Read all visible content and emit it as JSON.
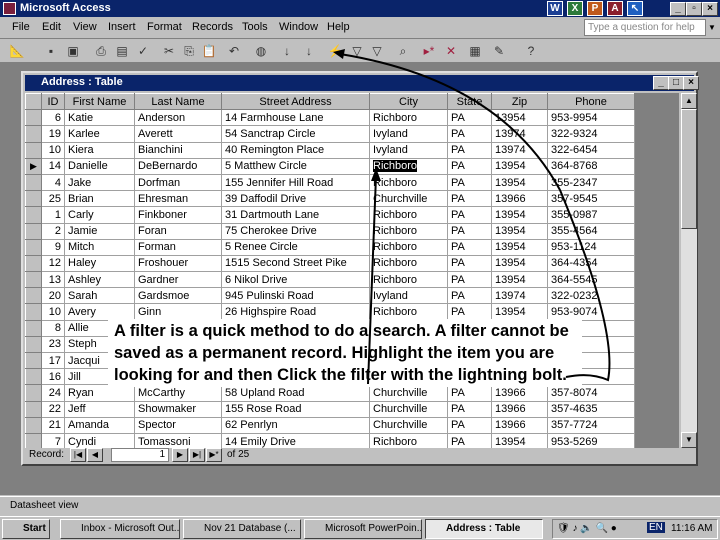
{
  "app": {
    "title": "Microsoft Access",
    "help_placeholder": "Type a question for help"
  },
  "menu": [
    "File",
    "Edit",
    "View",
    "Insert",
    "Format",
    "Records",
    "Tools",
    "Window",
    "Help"
  ],
  "window": {
    "title": "Address : Table"
  },
  "table": {
    "columns": [
      "ID",
      "First Name",
      "Last Name",
      "Street Address",
      "City",
      "State",
      "Zip",
      "Phone"
    ],
    "rows": [
      [
        "6",
        "Katie",
        "Anderson",
        "14 Farmhouse Lane",
        "Richboro",
        "PA",
        "13954",
        "953-9954"
      ],
      [
        "19",
        "Karlee",
        "Averett",
        "54 Sanctrap Circle",
        "Ivyland",
        "PA",
        "13974",
        "322-9324"
      ],
      [
        "10",
        "Kiera",
        "Bianchini",
        "40 Remington Place",
        "Ivyland",
        "PA",
        "13974",
        "322-6454"
      ],
      [
        "14",
        "Danielle",
        "DeBernardo",
        "5 Matthew Circle",
        "Richboro",
        "PA",
        "13954",
        "364-8768"
      ],
      [
        "4",
        "Jake",
        "Dorfman",
        "155 Jennifer Hill Road",
        "Richboro",
        "PA",
        "13954",
        "355-2347"
      ],
      [
        "25",
        "Brian",
        "Ehresman",
        "39 Daffodil Drive",
        "Churchville",
        "PA",
        "13966",
        "357-9545"
      ],
      [
        "1",
        "Carly",
        "Finkboner",
        "31 Dartmouth Lane",
        "Richboro",
        "PA",
        "13954",
        "355-0987"
      ],
      [
        "2",
        "Jamie",
        "Foran",
        "75 Cherokee Drive",
        "Richboro",
        "PA",
        "13954",
        "355-4564"
      ],
      [
        "9",
        "Mitch",
        "Forman",
        "5 Renee Circle",
        "Richboro",
        "PA",
        "13954",
        "953-1124"
      ],
      [
        "12",
        "Haley",
        "Froshouer",
        "1515 Second Street Pike",
        "Richboro",
        "PA",
        "13954",
        "364-4354"
      ],
      [
        "13",
        "Ashley",
        "Gardner",
        "6 Nikol Drive",
        "Richboro",
        "PA",
        "13954",
        "364-5545"
      ],
      [
        "20",
        "Sarah",
        "Gardsmoe",
        "945 Pulinski Road",
        "Ivyland",
        "PA",
        "13974",
        "322-0232"
      ],
      [
        "10",
        "Avery",
        "Ginn",
        "26 Highspire Road",
        "Richboro",
        "PA",
        "13954",
        "953-9074"
      ],
      [
        "8",
        "Allie",
        "",
        "",
        "",
        "",
        "",
        "55"
      ],
      [
        "23",
        "Steph",
        "",
        "",
        "",
        "",
        "",
        "24"
      ],
      [
        "17",
        "Jacqui",
        "",
        "",
        "",
        "",
        "",
        "63"
      ],
      [
        "16",
        "Jill",
        "",
        "",
        "",
        "",
        "",
        "78"
      ],
      [
        "24",
        "Ryan",
        "McCarthy",
        "58 Upland Road",
        "Churchville",
        "PA",
        "13966",
        "357-8074"
      ],
      [
        "22",
        "Jeff",
        "Showmaker",
        "155 Rose Road",
        "Churchville",
        "PA",
        "13966",
        "357-4635"
      ],
      [
        "21",
        "Amanda",
        "Spector",
        "62 Penrlyn",
        "Churchville",
        "PA",
        "13966",
        "357-7724"
      ],
      [
        "7",
        "Cyndi",
        "Tomassoni",
        "14 Emily Drive",
        "Richboro",
        "PA",
        "13954",
        "953-5269"
      ]
    ],
    "current_row": 3,
    "selected_cell": "Richboro"
  },
  "record_nav": {
    "label": "Record:",
    "current": "1",
    "of": "of 25"
  },
  "callout": "A filter is a quick method to do a search.  A filter cannot be saved as a permanent record.  Highlight the item you are looking for and then Click the filter with the lightning bolt.",
  "status": "Datasheet view",
  "taskbar": {
    "start": "Start",
    "tasks": [
      "Inbox - Microsoft Out...",
      "Nov 21   Database (...",
      "Microsoft PowerPoin...",
      "Address : Table"
    ],
    "lang": "EN",
    "clock": "11:16 AM"
  }
}
